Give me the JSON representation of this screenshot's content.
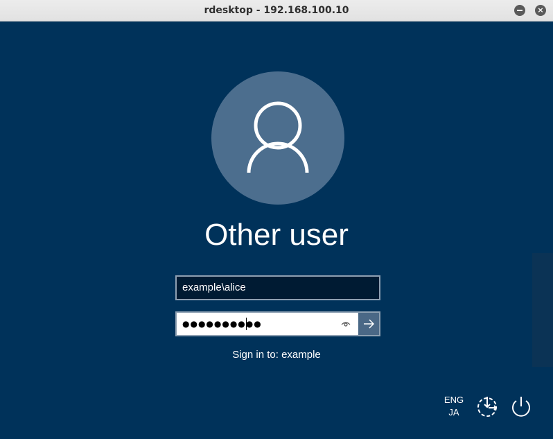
{
  "window": {
    "title": "rdesktop - 192.168.100.10",
    "minimize_icon": "minimize-icon",
    "close_icon": "close-icon",
    "close_glyph": "×"
  },
  "login": {
    "avatar_icon": "user-icon",
    "username_title": "Other user",
    "username_value": "example\\alice",
    "password_mask": "●●●●●●●●●●",
    "reveal_icon": "eye-icon",
    "submit_icon": "arrow-right-icon",
    "sign_in_to": "Sign in to: example"
  },
  "taskbar": {
    "lang_primary": "ENG",
    "lang_secondary": "JA",
    "ease_icon": "ease-of-access-icon",
    "power_icon": "power-icon"
  },
  "colors": {
    "background": "#00325a",
    "avatar_bg": "#4c6e8e",
    "submit_bg": "#4a6886"
  }
}
